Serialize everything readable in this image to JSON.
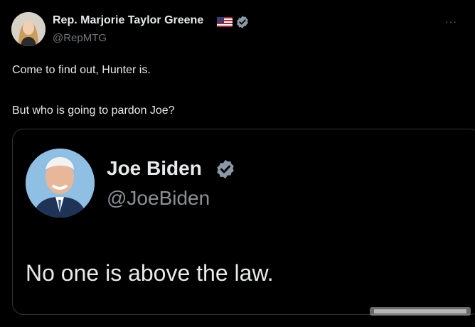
{
  "tweet": {
    "author": {
      "name": "Rep. Marjorie Taylor Greene",
      "handle": "@RepMTG",
      "avatar_icon": "profile-photo",
      "flag_icon": "us-flag-icon",
      "verified_icon": "verified-badge-icon"
    },
    "text_lines": [
      "Come to find out, Hunter is.",
      "But who is going to pardon Joe?"
    ],
    "more_icon": "···"
  },
  "quoted": {
    "name": "Joe Biden",
    "handle": "@JoeBiden",
    "text": "No one is above the law.",
    "avatar_icon": "profile-photo",
    "verified_icon": "verified-badge-icon"
  },
  "colors": {
    "background": "#000000",
    "primary_text": "#e7e9ea",
    "secondary_text": "#71767b",
    "verified": "#8b98a5",
    "border": "#2f3336"
  }
}
